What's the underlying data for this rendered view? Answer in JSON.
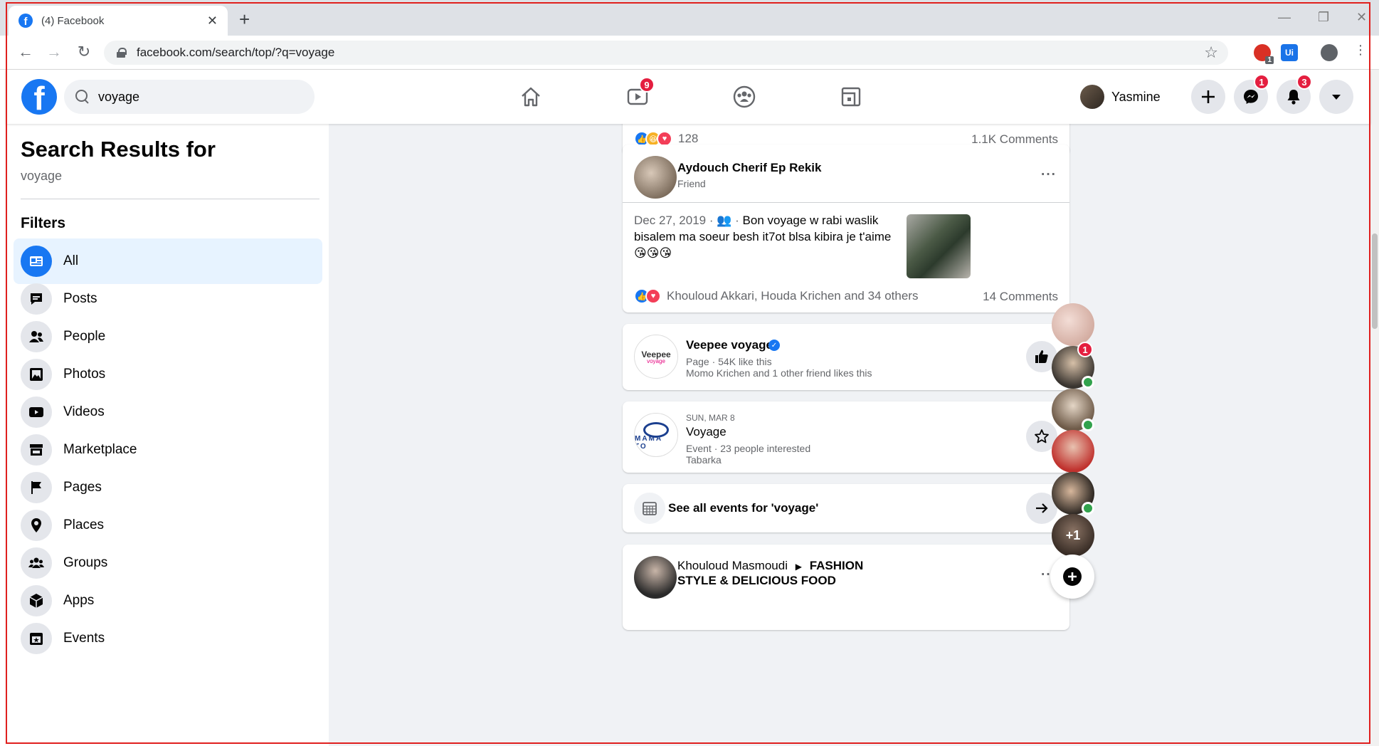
{
  "browser": {
    "tab_title": "(4) Facebook",
    "url": "facebook.com/search/top/?q=voyage",
    "ext_badge": "1",
    "ext_ui_label": "Ui"
  },
  "header": {
    "search_value": "voyage",
    "watch_badge": "9",
    "user_name": "Yasmine",
    "messenger_badge": "1",
    "notifications_badge": "3"
  },
  "sidebar": {
    "title": "Search Results for",
    "query": "voyage",
    "filters_heading": "Filters",
    "items": [
      {
        "label": "All",
        "icon": "feed-icon",
        "active": true
      },
      {
        "label": "Posts",
        "icon": "post-icon"
      },
      {
        "label": "People",
        "icon": "people-icon"
      },
      {
        "label": "Photos",
        "icon": "photos-icon"
      },
      {
        "label": "Videos",
        "icon": "videos-icon"
      },
      {
        "label": "Marketplace",
        "icon": "marketplace-icon"
      },
      {
        "label": "Pages",
        "icon": "flag-icon"
      },
      {
        "label": "Places",
        "icon": "pin-icon"
      },
      {
        "label": "Groups",
        "icon": "groups-icon"
      },
      {
        "label": "Apps",
        "icon": "apps-icon"
      },
      {
        "label": "Events",
        "icon": "events-icon"
      }
    ]
  },
  "feed": {
    "post0": {
      "reaction_count": "128",
      "comments": "1.1K Comments"
    },
    "post1": {
      "author": "Aydouch Cherif Ep Rekik",
      "relation": "Friend",
      "date": "Dec 27, 2019",
      "text": "Bon voyage w rabi waslik bisalem ma soeur besh it7ot blsa kibira je t'aime😘😘😘",
      "reactors": "Khouloud Akkari, Houda Krichen and 34 others",
      "comments": "14 Comments"
    },
    "page_result": {
      "name": "Veepee voyage",
      "logo_text": "Veepee",
      "logo_sub": "voyage",
      "meta": "Page · 54K like this",
      "friends": "Momo Krichen and 1 other friend likes this"
    },
    "event_result": {
      "date": "SUN, MAR 8",
      "name": "Voyage",
      "meta": "Event · 23 people interested",
      "location": "Tabarka",
      "logo_text": "MAMA TO"
    },
    "see_all_events": "See all events for 'voyage'",
    "post2": {
      "author": "Khouloud Masmoudi",
      "group": "FASHION STYLE & DELICIOUS FOOD"
    }
  },
  "contacts": {
    "badge": "1",
    "more_label": "+1"
  },
  "colors": {
    "fb_blue": "#1877f2",
    "badge_red": "#e41e3f",
    "online_green": "#31a24c",
    "active_filter_bg": "#e7f3ff"
  }
}
